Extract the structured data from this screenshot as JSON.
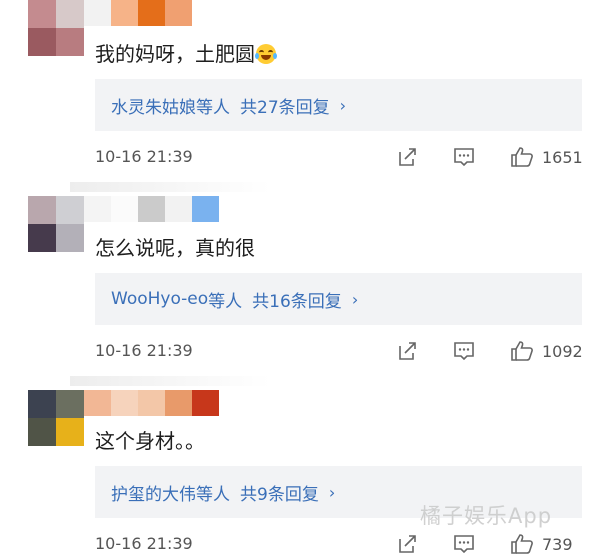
{
  "comments": [
    {
      "text": "我的妈呀，土肥圆",
      "reply_users": "水灵朱姑娘",
      "reply_suffix": "等人",
      "reply_count": "共27条回复",
      "timestamp": "10-16 21:39",
      "likes": "1651",
      "emoji": "rofl-emoji"
    },
    {
      "text": "怎么说呢，真的很",
      "reply_users": "WooHyo-eo",
      "reply_suffix": "等人",
      "reply_count": "共16条回复",
      "timestamp": "10-16 21:39",
      "likes": "1092"
    },
    {
      "text": "这个身材。。",
      "reply_users": "护玺的大伟",
      "reply_suffix": "等人",
      "reply_count": "共9条回复",
      "timestamp": "10-16 21:39",
      "likes": "739"
    }
  ],
  "chevron": "›",
  "watermark": "橘子娱乐App",
  "icons": {
    "share": "share-icon",
    "comment": "comment-icon",
    "like": "thumbs-up-icon"
  },
  "colors": {
    "link": "#3a6fb8",
    "reply_bg": "#f2f3f5",
    "meta": "#555555"
  }
}
